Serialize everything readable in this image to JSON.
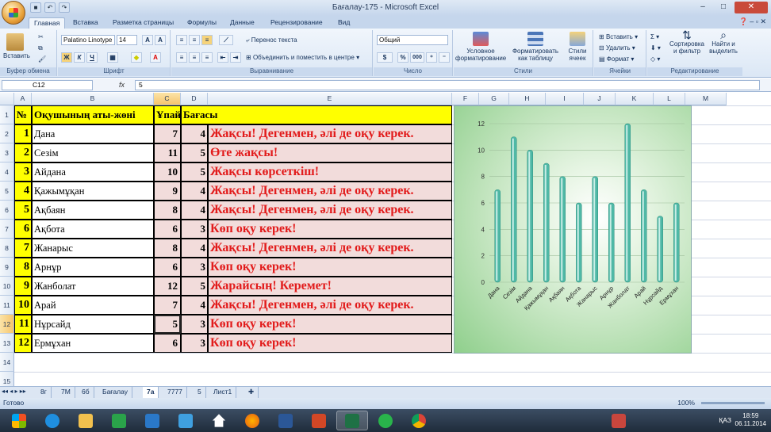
{
  "window": {
    "title": "Бағалау-175 - Microsoft Excel"
  },
  "ribbon_tabs": [
    "Главная",
    "Вставка",
    "Разметка страницы",
    "Формулы",
    "Данные",
    "Рецензирование",
    "Вид"
  ],
  "ribbon": {
    "paste": "Вставить",
    "clipboard_group": "Буфер обмена",
    "font_name": "Palatino Linotype",
    "font_size": "14",
    "font_group": "Шрифт",
    "wrap_text": "Перенос текста",
    "merge_center": "Объединить и поместить в центре",
    "align_group": "Выравнивание",
    "number_format": "Общий",
    "percent": "%",
    "thousands": "000",
    "number_group": "Число",
    "cond_format": "Условное форматирование",
    "format_table": "Форматировать как таблицу",
    "cell_styles": "Стили ячеек",
    "styles_group": "Стили",
    "insert": "Вставить",
    "delete": "Удалить",
    "format": "Формат",
    "cells_group": "Ячейки",
    "sort_filter": "Сортировка и фильтр",
    "find_select": "Найти и выделить",
    "edit_group": "Редактирование"
  },
  "formula_bar": {
    "name_box": "C12",
    "fx": "fx",
    "value": "5"
  },
  "columns": [
    "A",
    "B",
    "C",
    "D",
    "E",
    "F",
    "G",
    "H",
    "I",
    "J",
    "K",
    "L",
    "M"
  ],
  "rows": [
    "1",
    "2",
    "3",
    "4",
    "5",
    "6",
    "7",
    "8",
    "9",
    "10",
    "11",
    "12",
    "13",
    "14",
    "15"
  ],
  "table": {
    "headers": [
      "№",
      "Оқушының аты-жөні",
      "Ұпай",
      "Бағасы"
    ],
    "rows": [
      {
        "n": "1",
        "name": "Дана",
        "score": "7",
        "grade": "4",
        "comment": "Жақсы! Дегенмен, әлі де оқу керек."
      },
      {
        "n": "2",
        "name": "Сезім",
        "score": "11",
        "grade": "5",
        "comment": "Өте жақсы!"
      },
      {
        "n": "3",
        "name": "Айдана",
        "score": "10",
        "grade": "5",
        "comment": "Жақсы көрсеткіш!"
      },
      {
        "n": "4",
        "name": "Қажымұқан",
        "score": "9",
        "grade": "4",
        "comment": "Жақсы! Дегенмен, әлі де оқу керек."
      },
      {
        "n": "5",
        "name": "Ақбаян",
        "score": "8",
        "grade": "4",
        "comment": "Жақсы! Дегенмен, әлі де оқу керек."
      },
      {
        "n": "6",
        "name": "Ақбота",
        "score": "6",
        "grade": "3",
        "comment": "Көп оқу керек!"
      },
      {
        "n": "7",
        "name": "Жанарыс",
        "score": "8",
        "grade": "4",
        "comment": "Жақсы! Дегенмен, әлі де оқу керек."
      },
      {
        "n": "8",
        "name": "Арнұр",
        "score": "6",
        "grade": "3",
        "comment": "Көп оқу керек!"
      },
      {
        "n": "9",
        "name": "Жанболат",
        "score": "12",
        "grade": "5",
        "comment": "Жарайсың! Керемет!"
      },
      {
        "n": "10",
        "name": "Арай",
        "score": "7",
        "grade": "4",
        "comment": "Жақсы! Дегенмен, әлі де оқу керек."
      },
      {
        "n": "11",
        "name": "Нұрсайд",
        "score": "5",
        "grade": "3",
        "comment": "Көп оқу керек!"
      },
      {
        "n": "12",
        "name": "Ермұхан",
        "score": "6",
        "grade": "3",
        "comment": "Көп оқу керек!"
      }
    ]
  },
  "chart_data": {
    "type": "bar",
    "categories": [
      "Дана",
      "Сезім",
      "Айдана",
      "Қажымұқан",
      "Ақбаян",
      "Ақбота",
      "Жанарыс",
      "Арнұр",
      "Жанболат",
      "Арай",
      "Нұрсайд",
      "Ермұхан"
    ],
    "values": [
      7,
      11,
      10,
      9,
      8,
      6,
      8,
      6,
      12,
      7,
      5,
      6
    ],
    "ylim": [
      0,
      12
    ],
    "yticks": [
      "0",
      "2",
      "4",
      "6",
      "8",
      "10",
      "12"
    ],
    "grid": true,
    "bar_color": "#4fb8a6"
  },
  "sheet_tabs": [
    "8г",
    "7М",
    "6б",
    "Бағалау",
    "7а",
    "7777",
    "5",
    "Лист1"
  ],
  "active_sheet": "7а",
  "status": {
    "text": "Готово",
    "zoom": "100%"
  },
  "taskbar": {
    "lang": "ҚАЗ",
    "time": "18:59",
    "date": "06.11.2014"
  },
  "colors": {
    "header_yellow": "#ffff00",
    "pink": "#f2dcdb",
    "comment_red": "#e21b1b"
  }
}
